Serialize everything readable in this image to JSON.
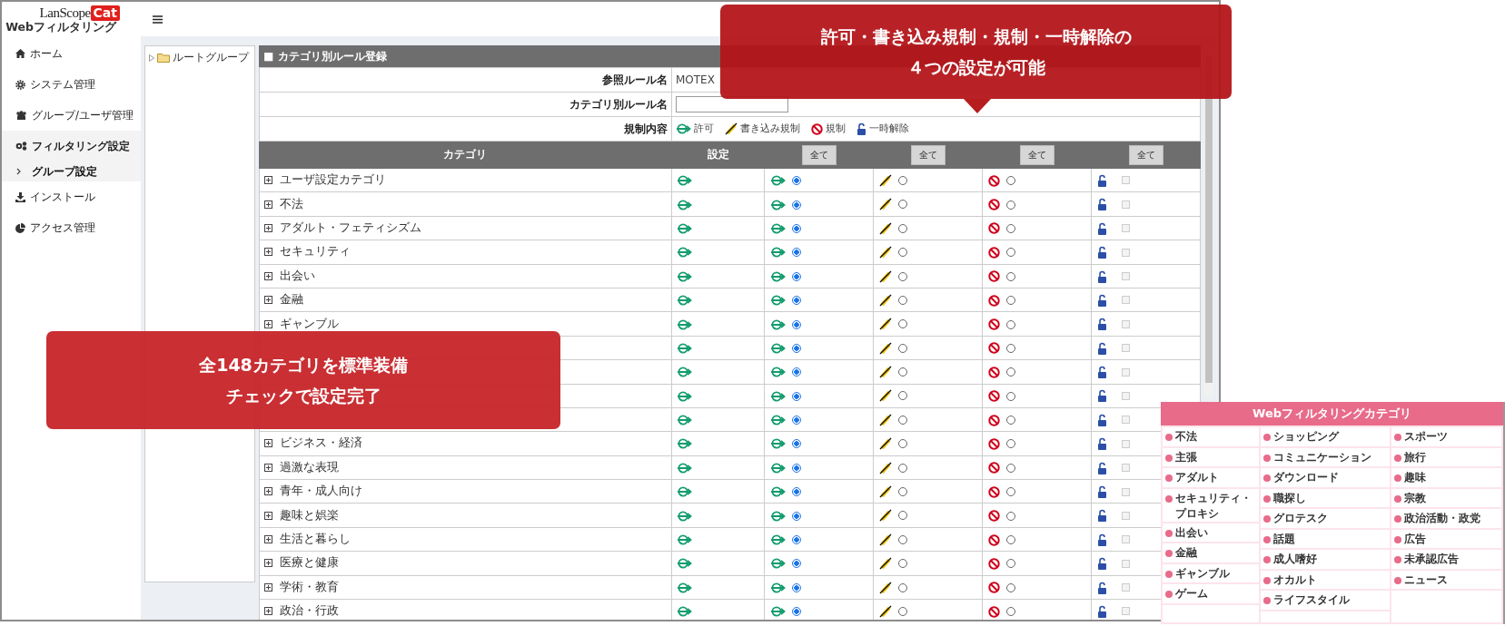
{
  "logo": {
    "name": "LanScope",
    "badge": "Cat",
    "subtitle": "Webフィルタリング"
  },
  "sidebar": {
    "items": [
      {
        "label": "ホーム",
        "kind": "home",
        "selected": false
      },
      {
        "label": "システム管理",
        "kind": "gear",
        "selected": false
      },
      {
        "label": "グループ/ユーザ管理",
        "kind": "users",
        "selected": false
      },
      {
        "label": "フィルタリング設定",
        "kind": "gears",
        "selected": true,
        "children": [
          {
            "label": "グループ設定",
            "selected": true
          }
        ]
      },
      {
        "label": "インストール",
        "kind": "download",
        "selected": false
      },
      {
        "label": "アクセス管理",
        "kind": "pie",
        "selected": false
      }
    ]
  },
  "tree": {
    "items": [
      {
        "label": "ルートグループ",
        "expanded": false
      }
    ]
  },
  "panel": {
    "title": "■ カテゴリ別ルール登録",
    "form": [
      {
        "label": "参照ルール名",
        "kind": "text",
        "value": "MOTEX"
      },
      {
        "label": "カテゴリ別ルール名",
        "kind": "input"
      },
      {
        "label": "規制内容",
        "kind": "legend",
        "items": [
          {
            "kind": "allow",
            "label": "許可"
          },
          {
            "kind": "write",
            "label": "書き込み規制"
          },
          {
            "kind": "block",
            "label": "規制"
          },
          {
            "kind": "unlock",
            "label": "一時解除"
          }
        ]
      }
    ],
    "columns": [
      {
        "label": "カテゴリ"
      },
      {
        "label": "設定"
      },
      {
        "button": "全て"
      },
      {
        "button": "全て"
      },
      {
        "button": "全て"
      },
      {
        "button": "全て"
      }
    ],
    "rows": [
      {
        "label": "ユーザ設定カテゴリ",
        "options": [
          {
            "kind": "allow",
            "selected": true
          },
          {
            "kind": "write",
            "selected": false
          },
          {
            "kind": "block",
            "selected": false
          },
          {
            "kind": "unlock",
            "checked": false,
            "disabled": true
          }
        ]
      },
      {
        "label": "不法",
        "options": [
          {
            "kind": "allow",
            "selected": true
          },
          {
            "kind": "write",
            "selected": false
          },
          {
            "kind": "block",
            "selected": false
          },
          {
            "kind": "unlock",
            "checked": false,
            "disabled": true
          }
        ]
      },
      {
        "label": "アダルト・フェティシズム",
        "options": [
          {
            "kind": "allow",
            "selected": true
          },
          {
            "kind": "write",
            "selected": false
          },
          {
            "kind": "block",
            "selected": false
          },
          {
            "kind": "unlock",
            "checked": false,
            "disabled": true
          }
        ]
      },
      {
        "label": "セキュリティ",
        "options": [
          {
            "kind": "allow",
            "selected": true
          },
          {
            "kind": "write",
            "selected": false
          },
          {
            "kind": "block",
            "selected": false
          },
          {
            "kind": "unlock",
            "checked": false,
            "disabled": true
          }
        ]
      },
      {
        "label": "出会い",
        "options": [
          {
            "kind": "allow",
            "selected": true
          },
          {
            "kind": "write",
            "selected": false
          },
          {
            "kind": "block",
            "selected": false
          },
          {
            "kind": "unlock",
            "checked": false,
            "disabled": true
          }
        ]
      },
      {
        "label": "金融",
        "options": [
          {
            "kind": "allow",
            "selected": true
          },
          {
            "kind": "write",
            "selected": false
          },
          {
            "kind": "block",
            "selected": false
          },
          {
            "kind": "unlock",
            "checked": false,
            "disabled": true
          }
        ]
      },
      {
        "label": "ギャンブル",
        "options": [
          {
            "kind": "allow",
            "selected": true
          },
          {
            "kind": "write",
            "selected": false
          },
          {
            "kind": "block",
            "selected": false
          },
          {
            "kind": "unlock",
            "checked": false,
            "disabled": true
          }
        ]
      },
      {
        "options": [
          {
            "kind": "allow",
            "selected": true
          },
          {
            "kind": "write",
            "selected": false
          },
          {
            "kind": "block",
            "selected": false
          },
          {
            "kind": "unlock",
            "checked": false,
            "disabled": true
          }
        ]
      },
      {
        "options": [
          {
            "kind": "allow",
            "selected": true
          },
          {
            "kind": "write",
            "selected": false
          },
          {
            "kind": "block",
            "selected": false
          },
          {
            "kind": "unlock",
            "checked": false,
            "disabled": true
          }
        ]
      },
      {
        "options": [
          {
            "kind": "allow",
            "selected": true
          },
          {
            "kind": "write",
            "selected": false
          },
          {
            "kind": "block",
            "selected": false
          },
          {
            "kind": "unlock",
            "checked": false,
            "disabled": true
          }
        ]
      },
      {
        "options": [
          {
            "kind": "allow",
            "selected": true
          },
          {
            "kind": "write",
            "selected": false
          },
          {
            "kind": "block",
            "selected": false
          },
          {
            "kind": "unlock",
            "checked": false,
            "disabled": true
          }
        ]
      },
      {
        "label": "ビジネス・経済",
        "options": [
          {
            "kind": "allow",
            "selected": true
          },
          {
            "kind": "write",
            "selected": false
          },
          {
            "kind": "block",
            "selected": false
          },
          {
            "kind": "unlock",
            "checked": false,
            "disabled": true
          }
        ]
      },
      {
        "label": "過激な表現",
        "options": [
          {
            "kind": "allow",
            "selected": true
          },
          {
            "kind": "write",
            "selected": false
          },
          {
            "kind": "block",
            "selected": false
          },
          {
            "kind": "unlock",
            "checked": false,
            "disabled": true
          }
        ]
      },
      {
        "label": "青年・成人向け",
        "options": [
          {
            "kind": "allow",
            "selected": true
          },
          {
            "kind": "write",
            "selected": false
          },
          {
            "kind": "block",
            "selected": false
          },
          {
            "kind": "unlock",
            "checked": false,
            "disabled": true
          }
        ]
      },
      {
        "label": "趣味と娯楽",
        "options": [
          {
            "kind": "allow",
            "selected": true
          },
          {
            "kind": "write",
            "selected": false
          },
          {
            "kind": "block",
            "selected": false
          },
          {
            "kind": "unlock",
            "checked": false,
            "disabled": true
          }
        ]
      },
      {
        "label": "生活と暮らし",
        "options": [
          {
            "kind": "allow",
            "selected": true
          },
          {
            "kind": "write",
            "selected": false
          },
          {
            "kind": "block",
            "selected": false
          },
          {
            "kind": "unlock",
            "checked": false,
            "disabled": true
          }
        ]
      },
      {
        "label": "医療と健康",
        "options": [
          {
            "kind": "allow",
            "selected": true
          },
          {
            "kind": "write",
            "selected": false
          },
          {
            "kind": "block",
            "selected": false
          },
          {
            "kind": "unlock",
            "checked": false,
            "disabled": true
          }
        ]
      },
      {
        "label": "学術・教育",
        "options": [
          {
            "kind": "allow",
            "selected": true
          },
          {
            "kind": "write",
            "selected": false
          },
          {
            "kind": "block",
            "selected": false
          },
          {
            "kind": "unlock",
            "checked": false,
            "disabled": true
          }
        ]
      },
      {
        "label": "政治・行政",
        "options": [
          {
            "kind": "allow",
            "selected": true
          },
          {
            "kind": "write",
            "selected": false
          },
          {
            "kind": "block",
            "selected": false
          },
          {
            "kind": "unlock",
            "checked": false,
            "disabled": true
          }
        ]
      }
    ]
  },
  "callouts": [
    {
      "kind": "pointed",
      "lines": [
        "許可・書き込み規制・規制・一時解除の",
        "４つの設定が可能"
      ]
    },
    {
      "kind": "plain",
      "lines": [
        "全148カテゴリを標準装備",
        "チェックで設定完了"
      ]
    }
  ],
  "inset": {
    "title": "Webフィルタリングカテゴリ",
    "columns": [
      [
        "不法",
        "主張",
        "アダルト",
        "セキュリティ・プロキシ",
        "出会い",
        "金融",
        "ギャンブル",
        "ゲーム"
      ],
      [
        "ショッピング",
        "コミュニケーション",
        "ダウンロード",
        "職探し",
        "グロテスク",
        "話題",
        "成人嗜好",
        "オカルト",
        "ライフスタイル"
      ],
      [
        "スポーツ",
        "旅行",
        "趣味",
        "宗教",
        "政治活動・政党",
        "広告",
        "未承認広告",
        "ニュース"
      ]
    ]
  }
}
